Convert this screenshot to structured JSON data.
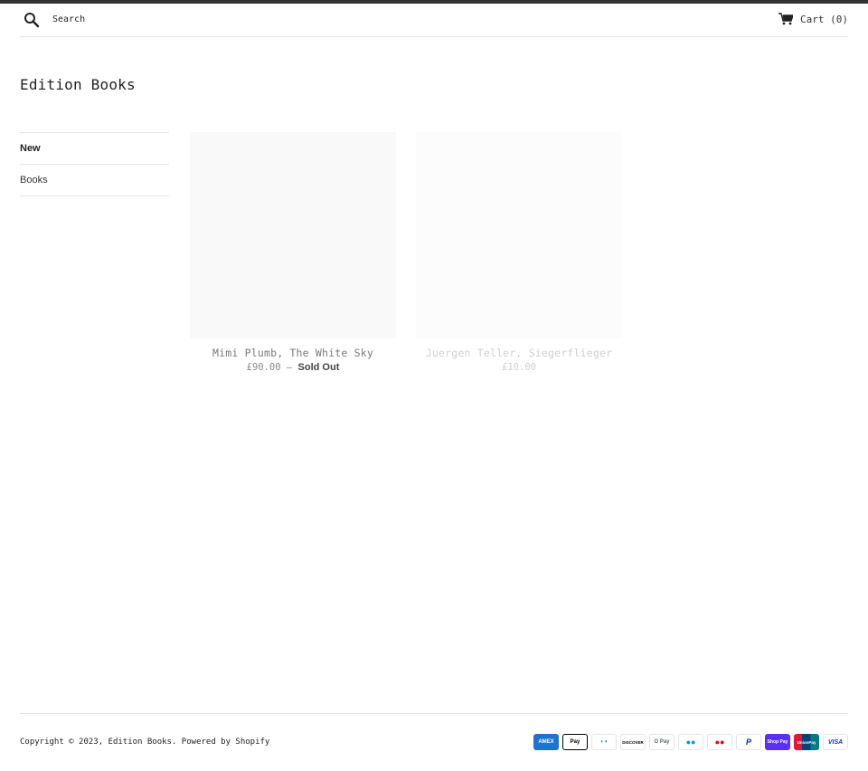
{
  "header": {
    "search_placeholder": "Search",
    "cart_label": "Cart (0)"
  },
  "site": {
    "title": "Edition Books"
  },
  "sidebar": {
    "items": [
      {
        "label": "New"
      },
      {
        "label": "Books"
      }
    ]
  },
  "products": [
    {
      "name": "Mimi Plumb, The White Sky",
      "price": "£90.00",
      "separator": "—",
      "status": "Sold Out"
    },
    {
      "name": "Juergen Teller, Siegerflieger",
      "price": "£10.00"
    }
  ],
  "footer": {
    "copyright": "Copyright © 2023, Edition Books. Powered by Shopify",
    "payment_methods": [
      {
        "icon": "amex-icon",
        "label": "AMEX",
        "bg": "#1f72cd",
        "fg": "#ffffff"
      },
      {
        "icon": "apple-pay-icon",
        "label": " Pay",
        "bg": "#ffffff",
        "fg": "#000000"
      },
      {
        "icon": "diners-club-icon",
        "label": "◐◑",
        "bg": "#ffffff",
        "fg": "#0079be"
      },
      {
        "icon": "discover-icon",
        "label": "DISCOVER",
        "bg": "#ffffff",
        "fg": "#000000"
      },
      {
        "icon": "google-pay-icon",
        "label": "G Pay",
        "bg": "#ffffff",
        "fg": "#5f6368"
      },
      {
        "icon": "maestro-icon",
        "label": "●●",
        "bg": "#ffffff",
        "fg": "#eb001b"
      },
      {
        "icon": "mastercard-icon",
        "label": "●●",
        "bg": "#ffffff",
        "fg": "#f79e1b"
      },
      {
        "icon": "paypal-icon",
        "label": "P",
        "bg": "#ffffff",
        "fg": "#003087"
      },
      {
        "icon": "shop-pay-icon",
        "label": "Shop Pay",
        "bg": "#5a31f4",
        "fg": "#ffffff"
      },
      {
        "icon": "union-pay-icon",
        "label": "UnionPay",
        "bg": "#e21836",
        "fg": "#ffffff"
      },
      {
        "icon": "visa-icon",
        "label": "VISA",
        "bg": "#ffffff",
        "fg": "#1434cb"
      }
    ]
  }
}
